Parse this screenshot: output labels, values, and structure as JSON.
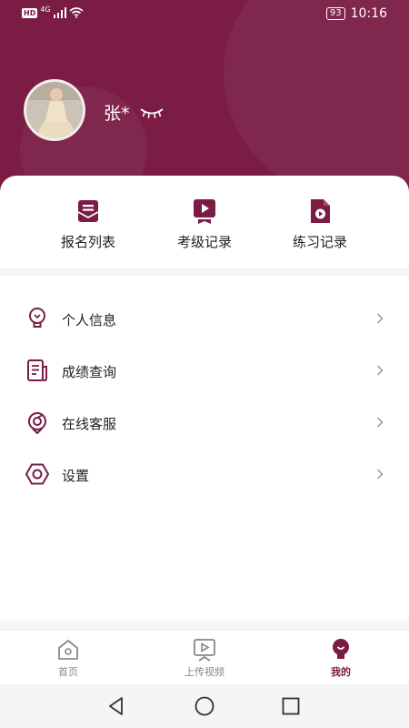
{
  "colors": {
    "accent": "#7a1c44",
    "text": "#222222",
    "tab_inactive": "#888888"
  },
  "status_bar": {
    "hd": "HD",
    "network": "4G",
    "battery": "93",
    "time": "10:16"
  },
  "profile": {
    "name": "张*"
  },
  "shortcuts": [
    {
      "label": "报名列表",
      "icon": "envelope-icon"
    },
    {
      "label": "考级记录",
      "icon": "video-badge-icon"
    },
    {
      "label": "练习记录",
      "icon": "video-file-icon"
    }
  ],
  "menu": [
    {
      "label": "个人信息",
      "icon": "lightbulb-icon"
    },
    {
      "label": "成绩查询",
      "icon": "document-icon"
    },
    {
      "label": "在线客服",
      "icon": "headset-icon"
    },
    {
      "label": "设置",
      "icon": "hexagon-settings-icon"
    }
  ],
  "tabs": [
    {
      "label": "首页",
      "icon": "home-icon",
      "active": false
    },
    {
      "label": "上传视频",
      "icon": "upload-video-icon",
      "active": false
    },
    {
      "label": "我的",
      "icon": "profile-icon",
      "active": true
    }
  ]
}
